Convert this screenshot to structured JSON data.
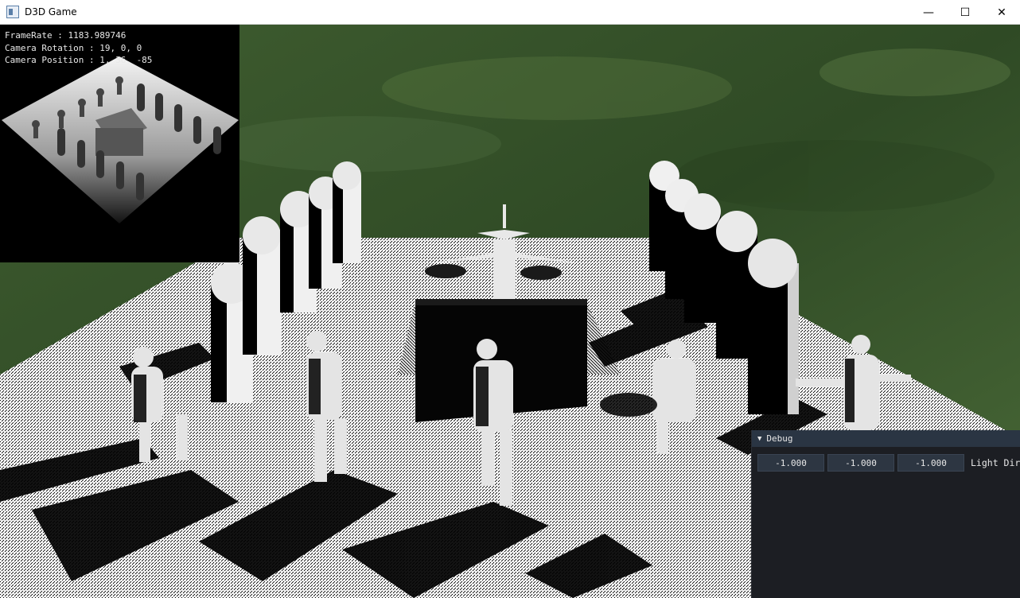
{
  "window": {
    "title": "D3D Game",
    "icon": "app-window-icon",
    "buttons": {
      "minimize": "—",
      "maximize": "☐",
      "close": "✕"
    }
  },
  "overlay": {
    "framerate": "FrameRate : 1183.989746",
    "camera_rotation": "Camera Rotation : 19, 0, 0",
    "camera_position": "Camera Position : 1, 36, -85"
  },
  "debug": {
    "header": "Debug",
    "light_dir": {
      "values": [
        "-1.000",
        "-1.000",
        "-1.000"
      ],
      "label": "Light Dir"
    }
  },
  "colors": {
    "grass_dark": "#2e4a22",
    "grass_light": "#4c6e36",
    "debug_bg": "#1c1e23",
    "debug_header": "#2a3543",
    "field_bg": "#2d3642"
  }
}
